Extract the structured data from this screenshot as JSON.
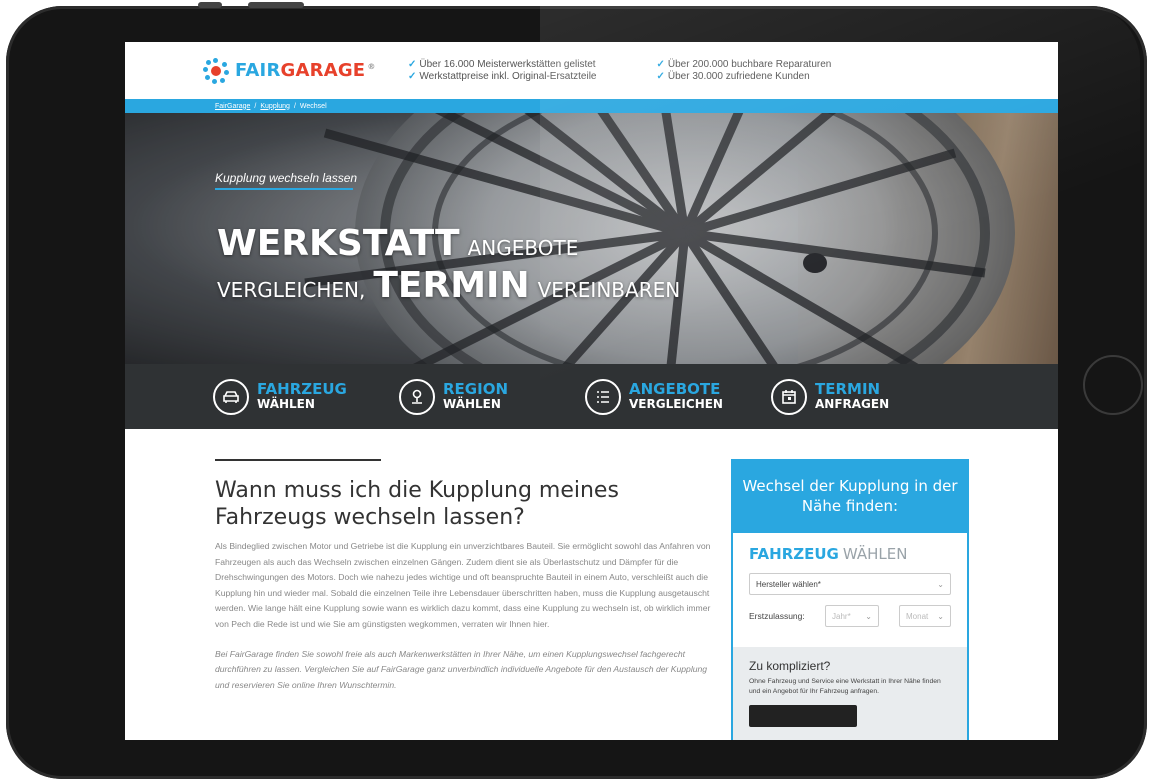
{
  "header": {
    "logo_fair": "FAIR",
    "logo_garage": "GARAGE",
    "logo_reg": "®",
    "usp_left": [
      "Über 16.000 Meisterwerkstätten gelistet",
      "Werkstattpreise inkl. Original-Ersatzteile"
    ],
    "usp_right": [
      "Über 200.000 buchbare Reparaturen",
      "Über 30.000 zufriedene Kunden"
    ],
    "check": "✓"
  },
  "breadcrumb": [
    "FairGarage",
    "Kupplung",
    "Wechsel"
  ],
  "breadcrumb_sep": "/",
  "hero": {
    "subtitle": "Kupplung wechseln lassen",
    "line1_big": "WERKSTATT",
    "line1_small": "ANGEBOTE",
    "line2_small_a": "VERGLEICHEN,",
    "line2_big": "TERMIN",
    "line2_small_b": "VEREINBAREN"
  },
  "steps": [
    {
      "title": "FAHRZEUG",
      "sub": "WÄHLEN",
      "icon": "car-icon"
    },
    {
      "title": "REGION",
      "sub": "WÄHLEN",
      "icon": "location-pin-icon"
    },
    {
      "title": "ANGEBOTE",
      "sub": "VERGLEICHEN",
      "icon": "list-icon"
    },
    {
      "title": "TERMIN",
      "sub": "ANFRAGEN",
      "icon": "calendar-icon"
    }
  ],
  "article": {
    "heading": "Wann muss ich die Kupplung meines Fahrzeugs wechseln lassen?",
    "para1": "Als Bindeglied zwischen Motor und Getriebe ist die Kupplung ein unverzichtbares Bauteil. Sie ermöglicht sowohl das Anfahren von Fahrzeugen als auch das Wechseln zwischen einzelnen Gängen. Zudem dient sie als Überlastschutz und Dämpfer für die Drehschwingungen des Motors. Doch wie nahezu jedes wichtige und oft beanspruchte Bauteil in einem Auto, verschleißt auch die Kupplung hin und wieder mal. Sobald die einzelnen Teile ihre Lebensdauer überschritten haben, muss die Kupplung ausgetauscht werden. Wie lange hält eine Kupplung sowie wann es wirklich dazu kommt, dass eine Kupplung zu wechseln ist, ob wirklich immer von Pech die Rede ist und wie Sie am günstigsten wegkommen, verraten wir Ihnen hier.",
    "para2": "Bei FairGarage finden Sie sowohl freie als auch Markenwerkstätten in Ihrer Nähe, um einen Kupplungswechsel fachgerecht durchführen zu lassen. Vergleichen Sie auf FairGarage ganz unverbindlich individuelle Angebote für den Austausch der Kupplung und reservieren Sie online Ihren Wunschtermin."
  },
  "finder": {
    "heading": "Wechsel der Kupplung in der Nähe finden:",
    "title_a": "FAHRZEUG",
    "title_b": "WÄHLEN",
    "manufacturer_placeholder": "Hersteller wählen*",
    "ez_label": "Erstzulassung:",
    "year_placeholder": "Jahr*",
    "month_placeholder": "Monat",
    "chevron": "⌄",
    "alt_title": "Zu kompliziert?",
    "alt_text": "Ohne Fahrzeug und Service eine Werkstatt in Ihrer Nähe finden und ein Angebot für Ihr Fahrzeug anfragen."
  },
  "colors": {
    "brand_blue": "#2aa7e0",
    "brand_red": "#e7412b",
    "steps_bg": "#2f3234"
  }
}
